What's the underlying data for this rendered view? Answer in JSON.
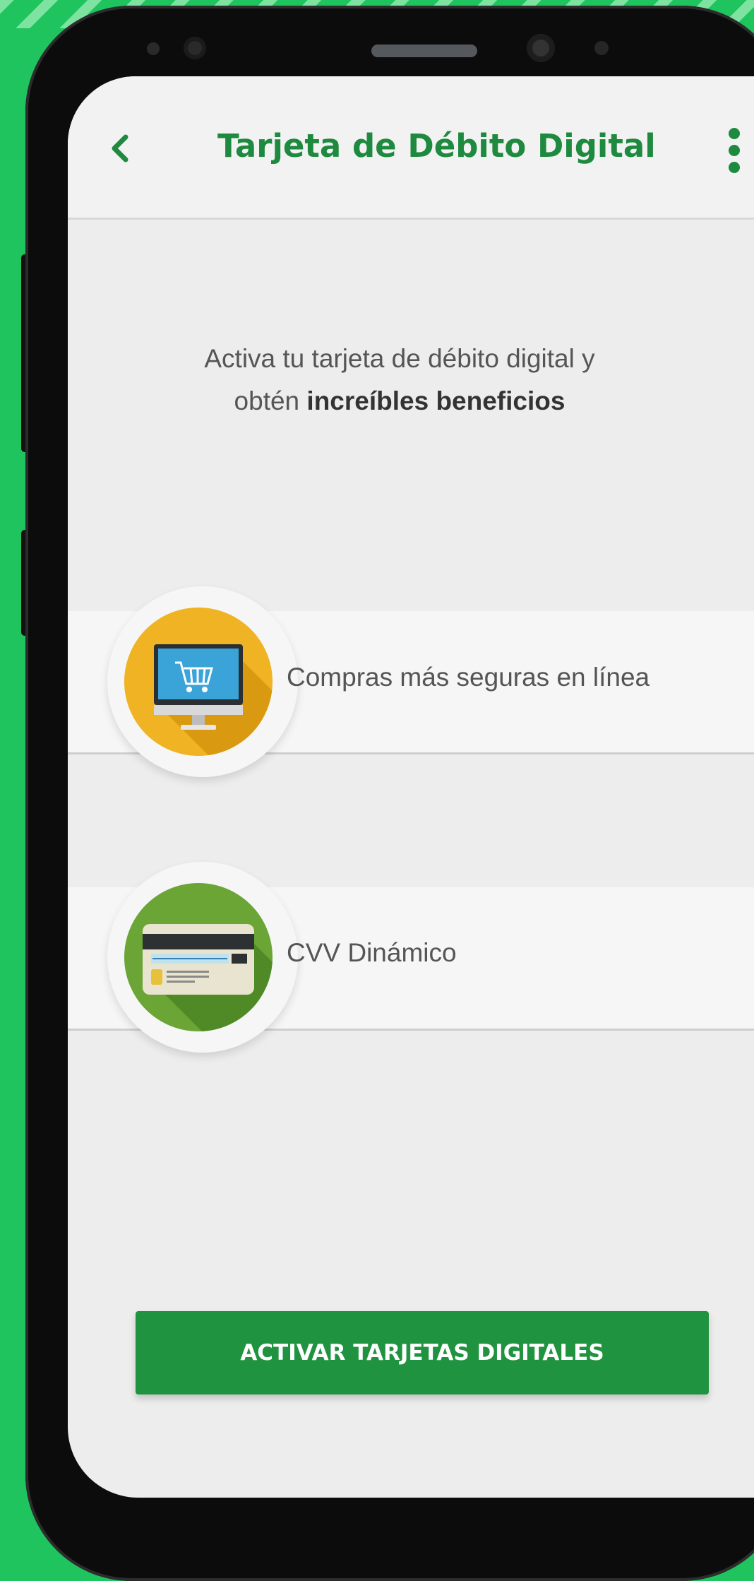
{
  "header": {
    "title": "Tarjeta de Débito Digital",
    "back_icon": "chevron-left-icon",
    "menu_icon": "more-vertical-icon"
  },
  "intro": {
    "line1": "Activa tu tarjeta de débito digital y",
    "line2_prefix": "obtén",
    "line2_bold": "increíbles beneficios"
  },
  "benefits": [
    {
      "label": "Compras más seguras en línea",
      "icon": "shopping-cart-monitor-icon"
    },
    {
      "label": "CVV Dinámico",
      "icon": "credit-card-back-icon"
    }
  ],
  "cta": {
    "label": "ACTIVAR TARJETAS DIGITALES"
  },
  "colors": {
    "brand_green": "#1e8a3f",
    "button_green": "#1f933f",
    "background_green": "#1fc45e"
  }
}
